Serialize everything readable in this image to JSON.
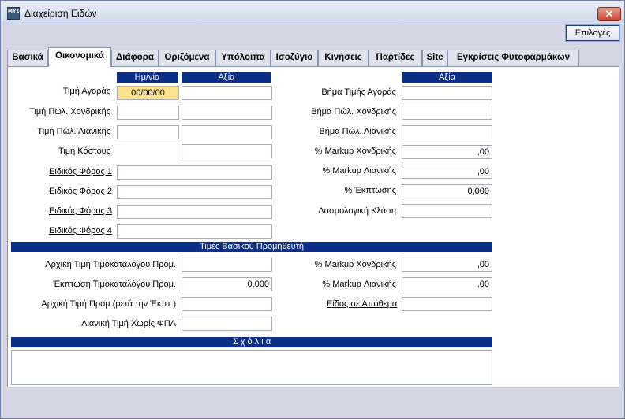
{
  "window": {
    "title": "Διαχείριση Ειδών",
    "icon_text": "ΜΥΣΟ"
  },
  "toolbar": {
    "options_label": "Επιλογές",
    "close_glyph": "✕"
  },
  "tabs": [
    "Βασικά",
    "Οικονομικά",
    "Διάφορα",
    "Οριζόμενα",
    "Υπόλοιπα",
    "Ισοζύγιο",
    "Κινήσεις",
    "Παρτίδες",
    "Site",
    "Εγκρίσεις Φυτοφαρμάκων"
  ],
  "active_tab": "Οικονομικά",
  "prices": {
    "header_date": "Ημ/νία",
    "header_value": "Αξία",
    "purchase_price_label": "Τιμή Αγοράς",
    "purchase_price_date": "00/00/00",
    "purchase_price_value": "",
    "wholesale_label": "Τιμή Πώλ. Χονδρικής",
    "wholesale_date": "",
    "wholesale_value": "",
    "retail_label": "Τιμή Πώλ. Λιανικής",
    "retail_date": "",
    "retail_value": "",
    "cost_label": "Τιμή Κόστους",
    "cost_value": "",
    "special_tax_1_label": "Ειδικός Φόρος 1",
    "special_tax_1_value": "",
    "special_tax_2_label": "Ειδικός Φόρος 2",
    "special_tax_2_value": "",
    "special_tax_3_label": "Ειδικός Φόρος 3",
    "special_tax_3_value": "",
    "special_tax_4_label": "Ειδικός Φόρος 4",
    "special_tax_4_value": ""
  },
  "steps": {
    "header_value": "Αξία",
    "purchase_step_label": "Βήμα Τιμής Αγοράς",
    "purchase_step_value": "",
    "wholesale_step_label": "Βήμα Πώλ. Χονδρικής",
    "wholesale_step_value": "",
    "retail_step_label": "Βήμα Πώλ. Λιανικής",
    "retail_step_value": "",
    "markup_wholesale_label": "% Markup Χονδρικής",
    "markup_wholesale_value": ",00",
    "markup_retail_label": "% Markup Λιανικής",
    "markup_retail_value": ",00",
    "discount_label": "% Έκπτωσης",
    "discount_value": "0,000",
    "tariff_class_label": "Δασμολογική Κλάση",
    "tariff_class_value": ""
  },
  "supplier": {
    "header": "Τιμές Βασικού Προμηθευτή",
    "list_price_label": "Αρχική Τιμή Τιμοκαταλόγου Προμ.",
    "list_price_value": "",
    "list_discount_label": "Έκπτωση Τιμοκαταλόγου Προμ.",
    "list_discount_value": "0,000",
    "net_price_label": "Αρχική Τιμή Προμ.(μετά την Έκπτ.)",
    "net_price_value": "",
    "retail_no_vat_label": "Λιανική Τιμή Χωρίς ΦΠΑ",
    "retail_no_vat_value": "",
    "markup_wholesale_label": "% Markup Χονδρικής",
    "markup_wholesale_value": ",00",
    "markup_retail_label": "% Markup Λιανικής",
    "markup_retail_value": ",00",
    "stock_item_label": "Είδος σε Απόθεμα",
    "stock_item_value": ""
  },
  "comments": {
    "header": "Σ χ ό λ ι α",
    "text": ""
  }
}
